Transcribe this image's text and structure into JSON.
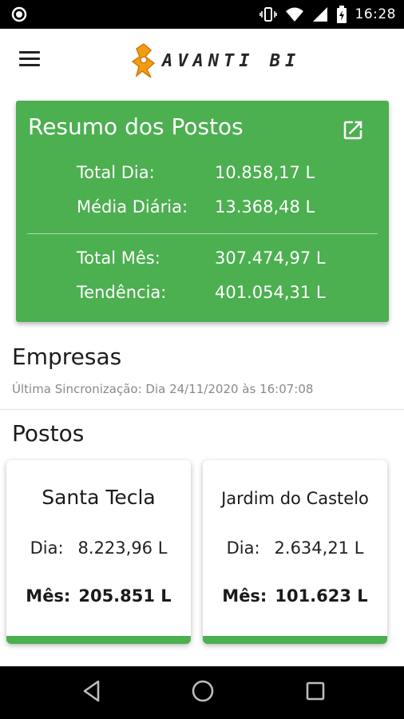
{
  "status_bar": {
    "time": "16:28",
    "icons": [
      "record-icon",
      "vibrate-icon",
      "wifi-icon",
      "signal-icon",
      "battery-charging-icon"
    ]
  },
  "app_bar": {
    "logo_text": "AVANTI BI",
    "menu_icon": "hamburger-menu-icon"
  },
  "summary": {
    "title": "Resumo dos Postos",
    "rows": [
      {
        "label": "Total Dia:",
        "value": "10.858,17 L"
      },
      {
        "label": "Média Diária:",
        "value": "13.368,48 L"
      },
      {
        "label": "Total Mês:",
        "value": "307.474,97 L"
      },
      {
        "label": "Tendência:",
        "value": "401.054,31 L"
      }
    ],
    "accent_color": "#4caf50"
  },
  "empresas": {
    "heading": "Empresas",
    "sync_text": "Última Sincronização: Dia 24/11/2020 às 16:07:08"
  },
  "postos": {
    "heading": "Postos",
    "cards": [
      {
        "name": "Santa Tecla",
        "dia_label": "Dia:",
        "dia_value": "8.223,96 L",
        "mes_label": "Mês:",
        "mes_value": "205.851 L"
      },
      {
        "name": "Jardim do Castelo",
        "dia_label": "Dia:",
        "dia_value": "2.634,21 L",
        "mes_label": "Mês:",
        "mes_value": "101.623 L"
      }
    ]
  },
  "nav_bar": {
    "buttons": [
      "back-icon",
      "home-icon",
      "recents-icon"
    ]
  }
}
